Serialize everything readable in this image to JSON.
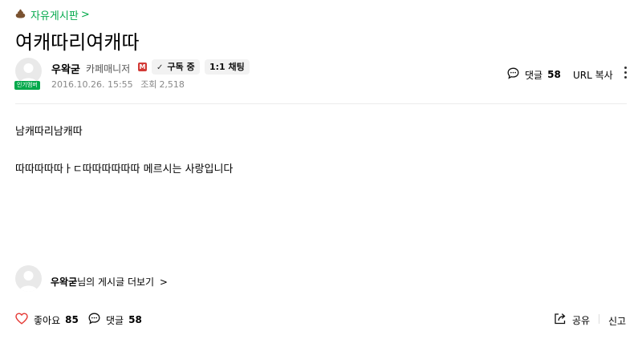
{
  "board": {
    "icon": "poop-icon",
    "name": "자유게시판",
    "chevron": ">"
  },
  "post": {
    "title": "여캐따리여캐따",
    "author": {
      "name": "우왁굳",
      "role": "카페매니저",
      "manager_badge": "M",
      "popular_badge": "인기멤버"
    },
    "subscribe_label": "구독 중",
    "chat_label": "1:1 채팅",
    "date": "2016.10.26. 15:55",
    "views_label": "조회",
    "views": "2,518",
    "comments_label": "댓글",
    "comments_count": "58",
    "url_copy_label": "URL 복사",
    "body_lines": [
      "남캐따리남캐따",
      "따따따따따ㅏㄷ따따따따따따 메르시는 사랑입니다"
    ]
  },
  "more_posts": {
    "author": "우왁굳",
    "suffix": "님의 게시글 더보기",
    "chevron": ">"
  },
  "footer": {
    "like_label": "좋아요",
    "like_count": "85",
    "comments_label": "댓글",
    "comments_count": "58",
    "share_label": "공유",
    "report_label": "신고"
  },
  "colors": {
    "accent": "#03a94b",
    "manager_badge": "#d23a36",
    "like_heart": "#e53935"
  }
}
